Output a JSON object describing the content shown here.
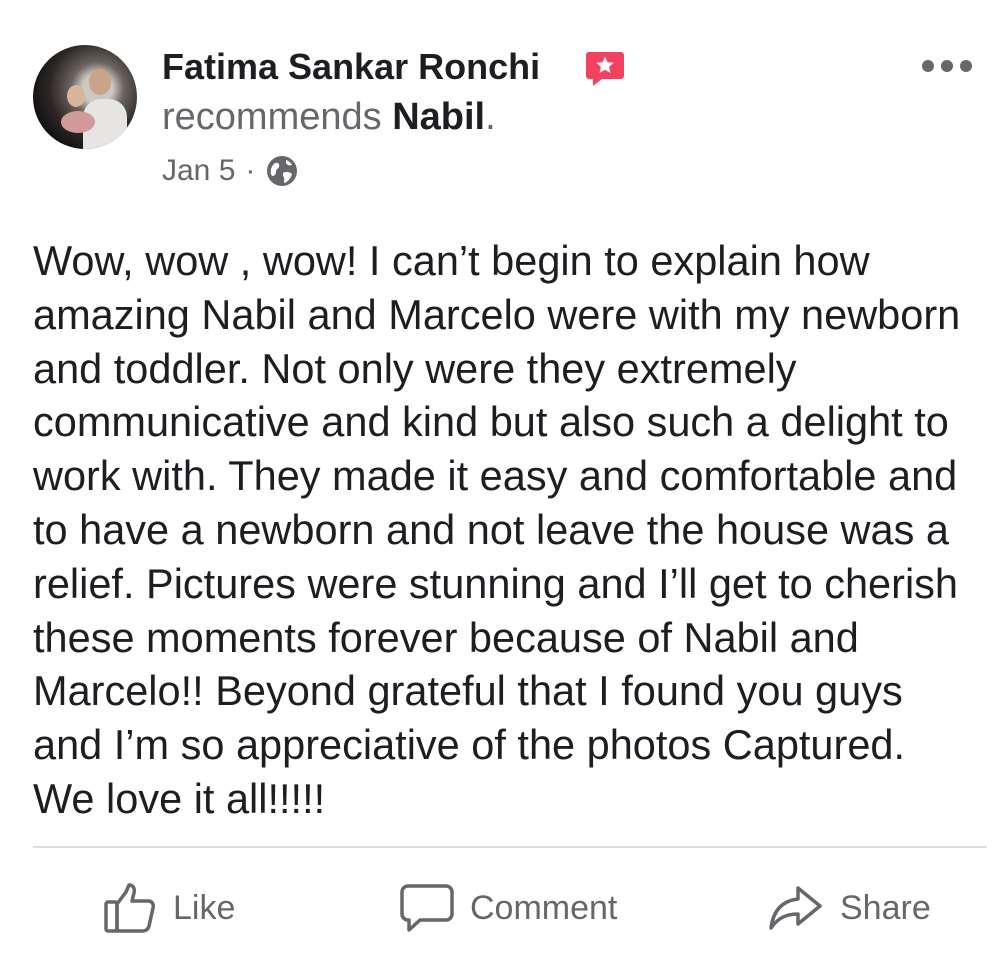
{
  "post": {
    "author_name": "Fatima Sankar Ronchi",
    "recommendation_prefix": "recommends",
    "recommended_page": "Nabil",
    "recommendation_suffix": ".",
    "date": "Jan 5",
    "separator": "·",
    "privacy_icon": "globe-icon",
    "badge_icon": "recommendation-star-icon",
    "options_icon": "more-options-icon",
    "text": "Wow, wow , wow! I can’t begin to explain how\namazing Nabil and Marcelo were with my newborn\nand toddler. Not only were they extremely\ncommunicative and kind but also such a delight to\nwork with. They made it easy and comfortable and\nto have a newborn and not leave the house was a\nrelief. Pictures were stunning and I’ll get to cherish\nthese moments forever because of Nabil and\nMarcelo!! Beyond grateful that I found you guys\nand I’m so appreciative of the photos Captured.\nWe love it all!!!!!"
  },
  "actions": {
    "like_label": "Like",
    "like_icon": "thumbs-up-icon",
    "comment_label": "Comment",
    "comment_icon": "speech-bubble-icon",
    "share_label": "Share",
    "share_icon": "share-arrow-icon"
  },
  "colors": {
    "text_primary": "#1c1e21",
    "text_secondary": "#65676b",
    "badge": "#f3425f",
    "divider": "#dadde1",
    "background": "#ffffff"
  }
}
